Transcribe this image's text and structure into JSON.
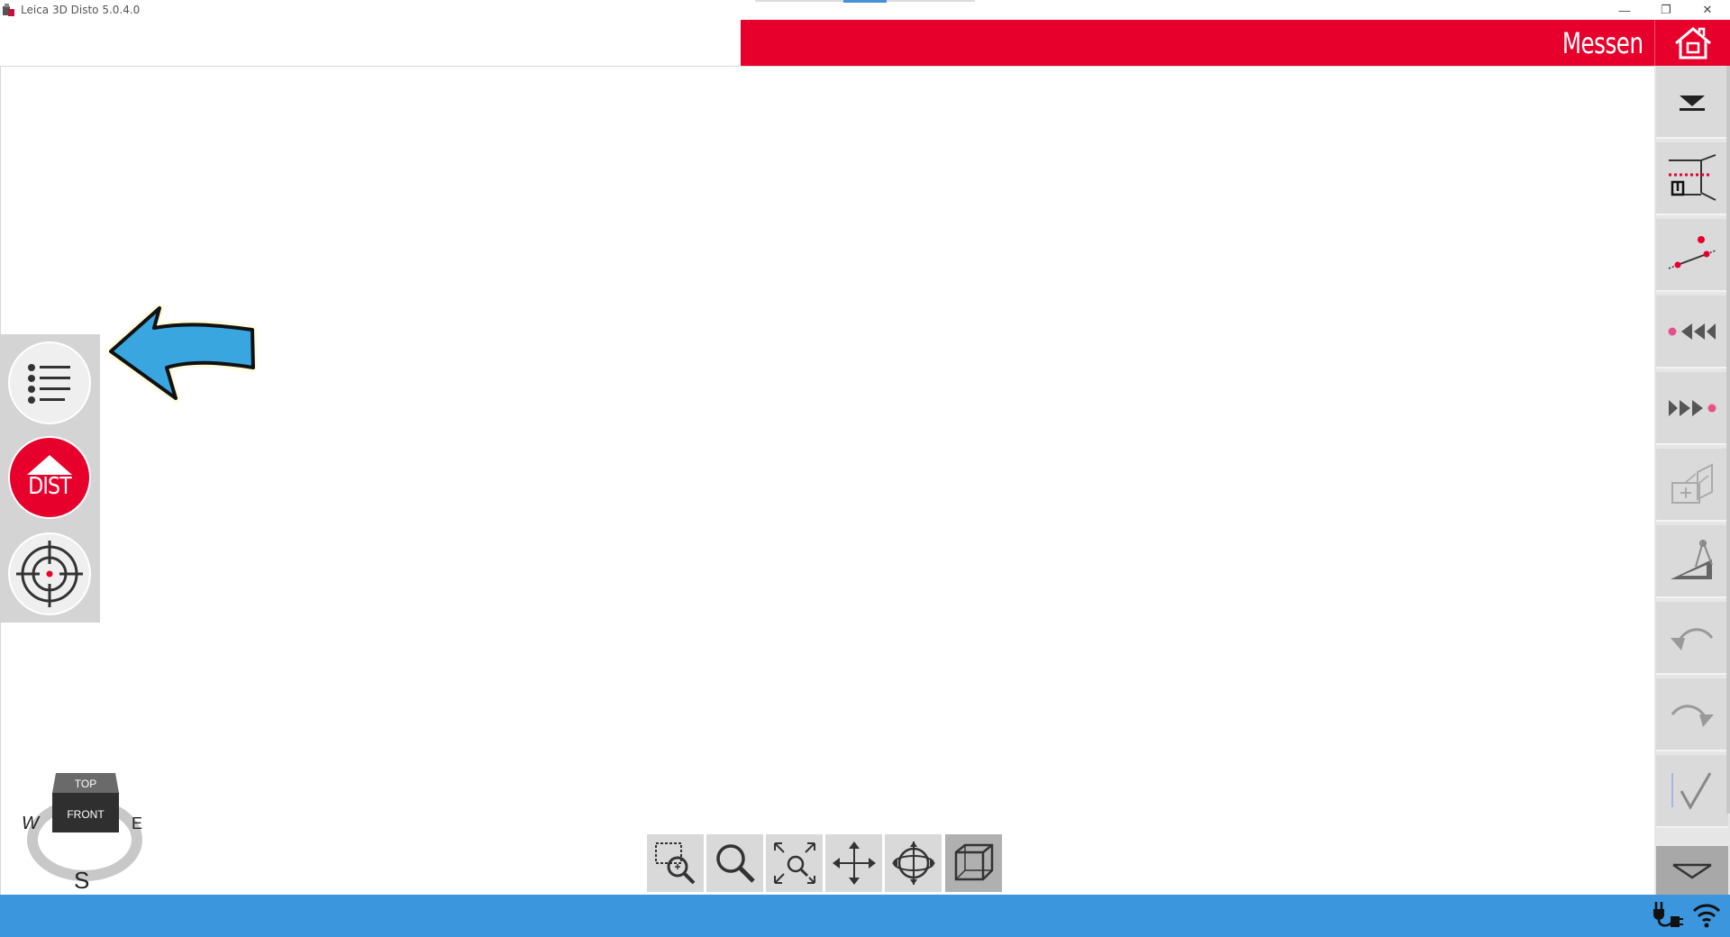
{
  "window": {
    "title": "Leica 3D Disto 5.0.4.0",
    "controls": {
      "minimize": "—",
      "restore": "❐",
      "close": "✕"
    }
  },
  "header": {
    "mode_title": "Messen",
    "home_icon": "home-icon"
  },
  "left_panel": {
    "list_icon": "list-icon",
    "dist_label": "DIST",
    "target_icon": "crosshair-target-icon"
  },
  "view_cube": {
    "top": "TOP",
    "front": "FRONT",
    "west": "W",
    "east": "E",
    "south": "S"
  },
  "right_toolbar": {
    "items": [
      {
        "name": "collapse-down",
        "icon": "arrow-down-bar-icon"
      },
      {
        "name": "height-tracking",
        "icon": "height-tracking-icon"
      },
      {
        "name": "point-line",
        "icon": "point-line-icon"
      },
      {
        "name": "previous-point",
        "icon": "rewind-point-icon"
      },
      {
        "name": "next-point",
        "icon": "forward-point-icon"
      },
      {
        "name": "add-object",
        "icon": "add-object-icon"
      },
      {
        "name": "angle-measure",
        "icon": "set-square-icon"
      },
      {
        "name": "undo",
        "icon": "undo-icon"
      },
      {
        "name": "redo",
        "icon": "redo-icon"
      },
      {
        "name": "confirm",
        "icon": "checkmark-icon"
      }
    ],
    "scroll_down_icon": "chevron-down-icon"
  },
  "nav_toolbar": {
    "items": [
      {
        "name": "zoom-window",
        "icon": "zoom-window-icon"
      },
      {
        "name": "zoom",
        "icon": "magnifier-icon"
      },
      {
        "name": "zoom-extents",
        "icon": "zoom-extents-icon"
      },
      {
        "name": "pan",
        "icon": "pan-move-icon"
      },
      {
        "name": "orbit",
        "icon": "orbit-icon"
      },
      {
        "name": "view-3d",
        "icon": "wireframe-box-icon"
      }
    ]
  },
  "colors": {
    "brand_red": "#e8002d",
    "status_blue": "#3b96dd",
    "arrow_blue": "#3aa6e0"
  },
  "status_bar": {
    "power_icon": "power-plug-icon",
    "wifi_icon": "wifi-icon"
  }
}
